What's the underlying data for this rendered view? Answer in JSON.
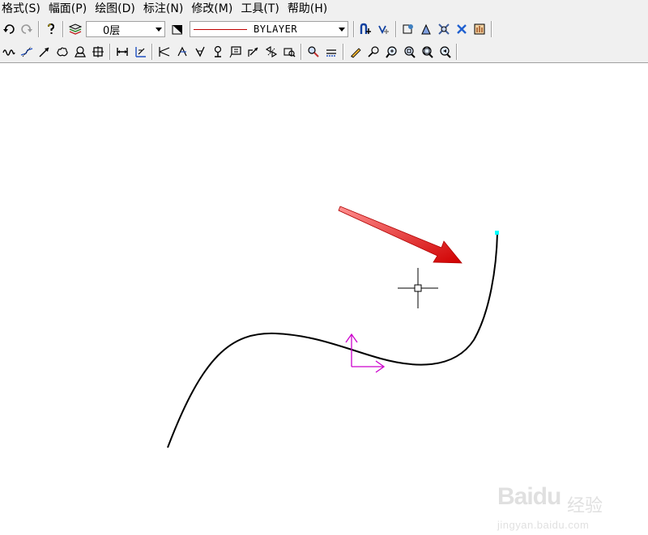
{
  "menubar": {
    "items": [
      "格式(S)",
      "幅面(P)",
      "绘图(D)",
      "标注(N)",
      "修改(M)",
      "工具(T)",
      "帮助(H)"
    ]
  },
  "toolbar": {
    "layer_value": "0层",
    "linetype_value": "BYLAYER",
    "linetype_color": "#c00000"
  },
  "drawing": {
    "curve_color": "#000000",
    "ucs_color": "#cc00cc",
    "grip_color": "#00ffff",
    "arrow_color": "#e01010"
  },
  "watermark": {
    "brand": "Baidu",
    "brand_cn": "经验",
    "url": "jingyan.baidu.com"
  }
}
